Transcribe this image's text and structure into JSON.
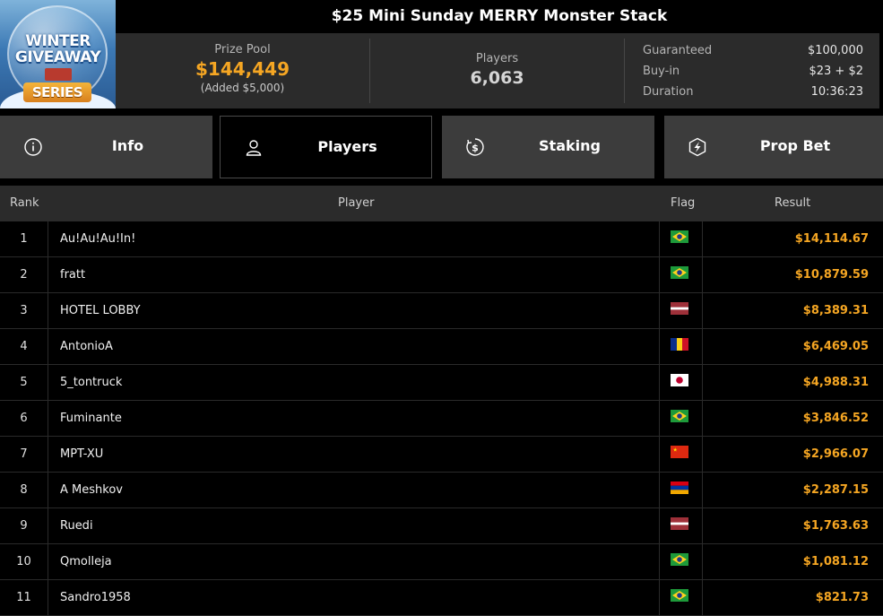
{
  "logo": {
    "line1": "WINTER",
    "line2": "GIVEAWAY",
    "line3": "SERIES"
  },
  "title": "$25 Mini Sunday MERRY Monster Stack",
  "prize_pool": {
    "label": "Prize Pool",
    "value": "$144,449",
    "added": "(Added $5,000)"
  },
  "players": {
    "label": "Players",
    "value": "6,063"
  },
  "details": [
    {
      "label": "Guaranteed",
      "value": "$100,000"
    },
    {
      "label": "Buy-in",
      "value": "$23 + $2"
    },
    {
      "label": "Duration",
      "value": "10:36:23"
    }
  ],
  "tabs": [
    {
      "label": "Info",
      "icon": "info-icon",
      "active": false
    },
    {
      "label": "Players",
      "icon": "user-icon",
      "active": true
    },
    {
      "label": "Staking",
      "icon": "dollar-coin-icon",
      "active": false
    },
    {
      "label": "Prop Bet",
      "icon": "lightning-shield-icon",
      "active": false
    }
  ],
  "table": {
    "headers": {
      "rank": "Rank",
      "player": "Player",
      "flag": "Flag",
      "result": "Result"
    },
    "rows": [
      {
        "rank": "1",
        "player": "Au!Au!Au!In!",
        "flag": "brazil",
        "result": "$14,114.67"
      },
      {
        "rank": "2",
        "player": "fratt",
        "flag": "brazil",
        "result": "$10,879.59"
      },
      {
        "rank": "3",
        "player": "HOTEL LOBBY",
        "flag": "latvia",
        "result": "$8,389.31"
      },
      {
        "rank": "4",
        "player": "AntonioA",
        "flag": "romania",
        "result": "$6,469.05"
      },
      {
        "rank": "5",
        "player": "5_tontruck",
        "flag": "japan",
        "result": "$4,988.31"
      },
      {
        "rank": "6",
        "player": "Fuminante",
        "flag": "brazil",
        "result": "$3,846.52"
      },
      {
        "rank": "7",
        "player": "MPT-XU",
        "flag": "china",
        "result": "$2,966.07"
      },
      {
        "rank": "8",
        "player": "A Meshkov",
        "flag": "armenia",
        "result": "$2,287.15"
      },
      {
        "rank": "9",
        "player": "Ruedi",
        "flag": "latvia",
        "result": "$1,763.63"
      },
      {
        "rank": "10",
        "player": "Qmolleja",
        "flag": "brazil",
        "result": "$1,081.12"
      },
      {
        "rank": "11",
        "player": "Sandro1958",
        "flag": "brazil",
        "result": "$821.73"
      }
    ]
  },
  "colors": {
    "accent": "#f5a623",
    "panel": "#2b2b2b",
    "tab": "#3c3c3c",
    "background": "#000000"
  }
}
